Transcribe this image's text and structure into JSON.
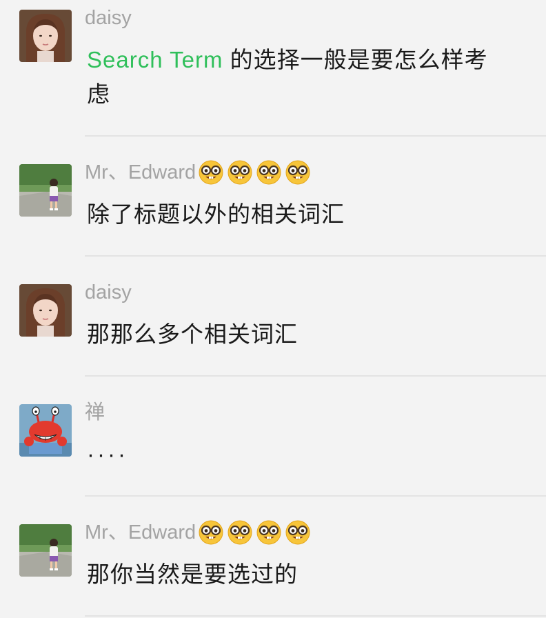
{
  "messages": [
    {
      "sender": "daisy",
      "avatar": "girl-portrait-avatar",
      "highlight": "Search Term",
      "text": " 的选择一般是要怎么样考虑"
    },
    {
      "sender": "Mr、Edward",
      "avatar": "child-running-avatar",
      "emoji": "nerd-face-icon",
      "emoji_count": 4,
      "text": "除了标题以外的相关词汇"
    },
    {
      "sender": "daisy",
      "avatar": "girl-portrait-avatar",
      "text": "那那么多个相关词汇"
    },
    {
      "sender": "禅",
      "avatar": "crab-cartoon-avatar",
      "text": "····"
    },
    {
      "sender": "Mr、Edward",
      "avatar": "child-running-avatar",
      "emoji": "nerd-face-icon",
      "emoji_count": 4,
      "text": "那你当然是要选过的"
    }
  ],
  "colors": {
    "background": "#f3f3f3",
    "sender_name": "#a3a3a3",
    "message_text": "#1a1a1a",
    "highlight": "#2fbf5a",
    "divider": "#e3e3e3"
  }
}
